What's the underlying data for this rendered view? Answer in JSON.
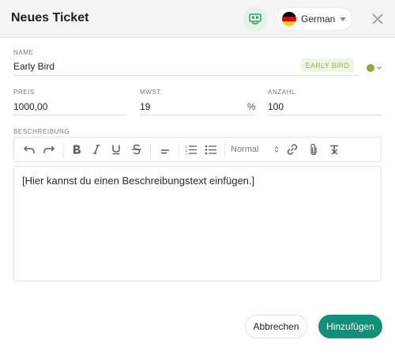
{
  "header": {
    "title": "Neues Ticket",
    "ticket_icon": "ticket-icon",
    "language": "German",
    "flag_colors": [
      "#000000",
      "#dd0000",
      "#ffce00"
    ],
    "close_icon": "close-icon"
  },
  "form": {
    "name": {
      "label": "NAME",
      "value": "Early Bird",
      "badge": "EARLY BIRD",
      "color": "#7db13b"
    },
    "preis": {
      "label": "PREIS",
      "value": "1000,00"
    },
    "mwst": {
      "label": "MWST.",
      "value": "19",
      "unit": "%"
    },
    "anzahl": {
      "label": "ANZAHL",
      "value": "100"
    },
    "beschreibung": {
      "label": "BESCHREIBUNG",
      "format_select": "Normal",
      "text": "[Hier kannst du einen Beschreibungstext einfügen.]"
    }
  },
  "toolbar_icons": [
    "undo-icon",
    "redo-icon",
    "bold-icon",
    "italic-icon",
    "underline-icon",
    "strikethrough-icon",
    "align-icon",
    "ordered-list-icon",
    "bullet-list-icon",
    "link-icon",
    "attachment-icon",
    "clear-format-icon"
  ],
  "buttons": {
    "cancel": "Abbrechen",
    "submit": "Hinzufügen"
  },
  "colors": {
    "primary": "#119077",
    "badge_text": "#8cb454",
    "badge_bg": "#eef6e3"
  }
}
